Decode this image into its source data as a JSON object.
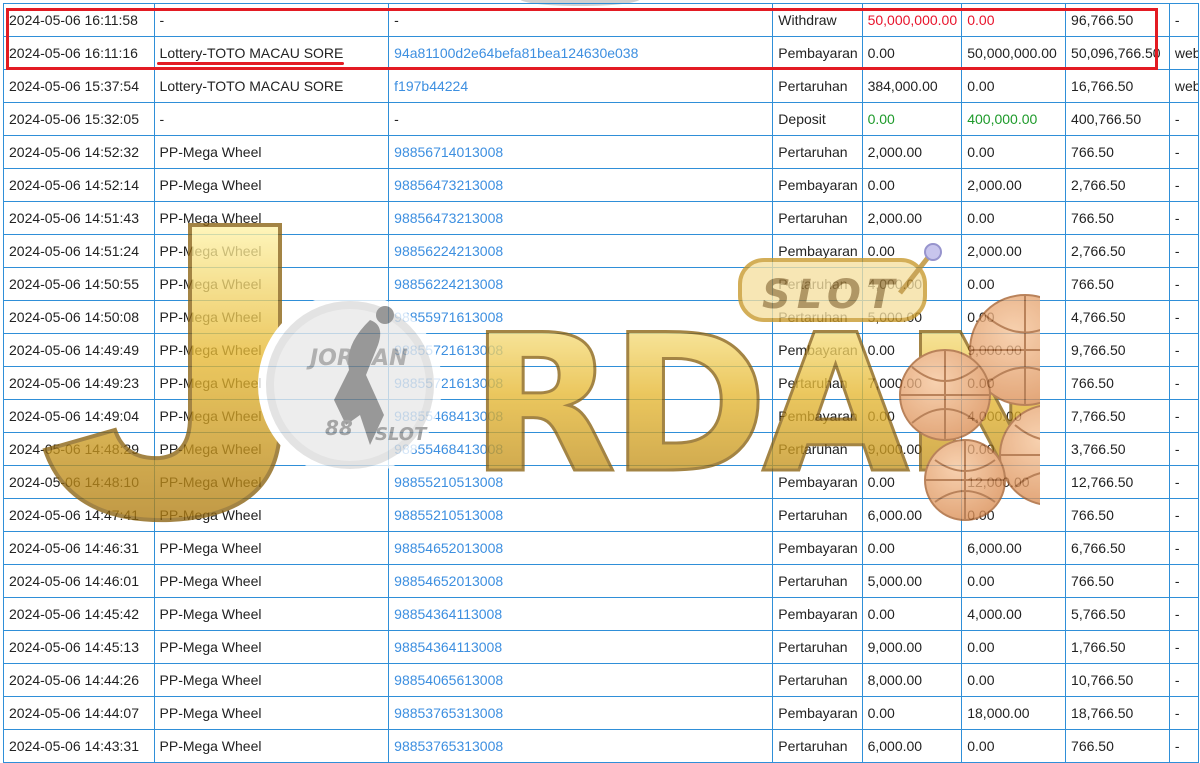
{
  "transactions": [
    {
      "date": "2024-05-06 16:11:58",
      "game": "-",
      "ref": "-",
      "type": "Withdraw",
      "debit": "50,000,000.00",
      "credit": "0.00",
      "balance": "96,766.50",
      "source": "-",
      "debit_color": "red",
      "credit_color": "red"
    },
    {
      "date": "2024-05-06 16:11:16",
      "game": "Lottery-TOTO MACAU SORE",
      "ref": "94a81100d2e64befa81bea124630e038",
      "type": "Pembayaran",
      "debit": "0.00",
      "credit": "50,000,000.00",
      "balance": "50,096,766.50",
      "source": "web"
    },
    {
      "date": "2024-05-06 15:37:54",
      "game": "Lottery-TOTO MACAU SORE",
      "ref": "f197b44224",
      "type": "Pertaruhan",
      "debit": "384,000.00",
      "credit": "0.00",
      "balance": "16,766.50",
      "source": "web"
    },
    {
      "date": "2024-05-06 15:32:05",
      "game": "-",
      "ref": "-",
      "type": "Deposit",
      "debit": "0.00",
      "credit": "400,000.00",
      "balance": "400,766.50",
      "source": "-",
      "debit_color": "green",
      "credit_color": "green"
    },
    {
      "date": "2024-05-06 14:52:32",
      "game": "PP-Mega Wheel",
      "ref": "98856714013008",
      "type": "Pertaruhan",
      "debit": "2,000.00",
      "credit": "0.00",
      "balance": "766.50",
      "source": "-"
    },
    {
      "date": "2024-05-06 14:52:14",
      "game": "PP-Mega Wheel",
      "ref": "98856473213008",
      "type": "Pembayaran",
      "debit": "0.00",
      "credit": "2,000.00",
      "balance": "2,766.50",
      "source": "-"
    },
    {
      "date": "2024-05-06 14:51:43",
      "game": "PP-Mega Wheel",
      "ref": "98856473213008",
      "type": "Pertaruhan",
      "debit": "2,000.00",
      "credit": "0.00",
      "balance": "766.50",
      "source": "-"
    },
    {
      "date": "2024-05-06 14:51:24",
      "game": "PP-Mega Wheel",
      "ref": "98856224213008",
      "type": "Pembayaran",
      "debit": "0.00",
      "credit": "2,000.00",
      "balance": "2,766.50",
      "source": "-"
    },
    {
      "date": "2024-05-06 14:50:55",
      "game": "PP-Mega Wheel",
      "ref": "98856224213008",
      "type": "Pertaruhan",
      "debit": "4,000.00",
      "credit": "0.00",
      "balance": "766.50",
      "source": "-"
    },
    {
      "date": "2024-05-06 14:50:08",
      "game": "PP-Mega Wheel",
      "ref": "98855971613008",
      "type": "Pertaruhan",
      "debit": "5,000.00",
      "credit": "0.00",
      "balance": "4,766.50",
      "source": "-"
    },
    {
      "date": "2024-05-06 14:49:49",
      "game": "PP-Mega Wheel",
      "ref": "98855721613008",
      "type": "Pembayaran",
      "debit": "0.00",
      "credit": "9,000.00",
      "balance": "9,766.50",
      "source": "-"
    },
    {
      "date": "2024-05-06 14:49:23",
      "game": "PP-Mega Wheel",
      "ref": "98855721613008",
      "type": "Pertaruhan",
      "debit": "7,000.00",
      "credit": "0.00",
      "balance": "766.50",
      "source": "-"
    },
    {
      "date": "2024-05-06 14:49:04",
      "game": "PP-Mega Wheel",
      "ref": "98855468413008",
      "type": "Pembayaran",
      "debit": "0.00",
      "credit": "4,000.00",
      "balance": "7,766.50",
      "source": "-"
    },
    {
      "date": "2024-05-06 14:48:29",
      "game": "PP-Mega Wheel",
      "ref": "98855468413008",
      "type": "Pertaruhan",
      "debit": "9,000.00",
      "credit": "0.00",
      "balance": "3,766.50",
      "source": "-"
    },
    {
      "date": "2024-05-06 14:48:10",
      "game": "PP-Mega Wheel",
      "ref": "98855210513008",
      "type": "Pembayaran",
      "debit": "0.00",
      "credit": "12,000.00",
      "balance": "12,766.50",
      "source": "-"
    },
    {
      "date": "2024-05-06 14:47:41",
      "game": "PP-Mega Wheel",
      "ref": "98855210513008",
      "type": "Pertaruhan",
      "debit": "6,000.00",
      "credit": "0.00",
      "balance": "766.50",
      "source": "-"
    },
    {
      "date": "2024-05-06 14:46:31",
      "game": "PP-Mega Wheel",
      "ref": "98854652013008",
      "type": "Pembayaran",
      "debit": "0.00",
      "credit": "6,000.00",
      "balance": "6,766.50",
      "source": "-"
    },
    {
      "date": "2024-05-06 14:46:01",
      "game": "PP-Mega Wheel",
      "ref": "98854652013008",
      "type": "Pertaruhan",
      "debit": "5,000.00",
      "credit": "0.00",
      "balance": "766.50",
      "source": "-"
    },
    {
      "date": "2024-05-06 14:45:42",
      "game": "PP-Mega Wheel",
      "ref": "98854364113008",
      "type": "Pembayaran",
      "debit": "0.00",
      "credit": "4,000.00",
      "balance": "5,766.50",
      "source": "-"
    },
    {
      "date": "2024-05-06 14:45:13",
      "game": "PP-Mega Wheel",
      "ref": "98854364113008",
      "type": "Pertaruhan",
      "debit": "9,000.00",
      "credit": "0.00",
      "balance": "1,766.50",
      "source": "-"
    },
    {
      "date": "2024-05-06 14:44:26",
      "game": "PP-Mega Wheel",
      "ref": "98854065613008",
      "type": "Pertaruhan",
      "debit": "8,000.00",
      "credit": "0.00",
      "balance": "10,766.50",
      "source": "-"
    },
    {
      "date": "2024-05-06 14:44:07",
      "game": "PP-Mega Wheel",
      "ref": "98853765313008",
      "type": "Pembayaran",
      "debit": "0.00",
      "credit": "18,000.00",
      "balance": "18,766.50",
      "source": "-"
    },
    {
      "date": "2024-05-06 14:43:31",
      "game": "PP-Mega Wheel",
      "ref": "98853765313008",
      "type": "Pertaruhan",
      "debit": "6,000.00",
      "credit": "0.00",
      "balance": "766.50",
      "source": "-"
    }
  ],
  "watermark": {
    "brand": "JORDAN",
    "sub": "SLOT",
    "badge_top": "JORDAN",
    "badge_num": "88",
    "badge_bottom": "SLOT"
  },
  "colors": {
    "grid": "#2f8fd8",
    "link": "#3d8fe0",
    "negative": "#e8142c",
    "positive": "#1d9a2a",
    "highlight": "#e31b23",
    "watermark_gold": "#e6b832"
  }
}
